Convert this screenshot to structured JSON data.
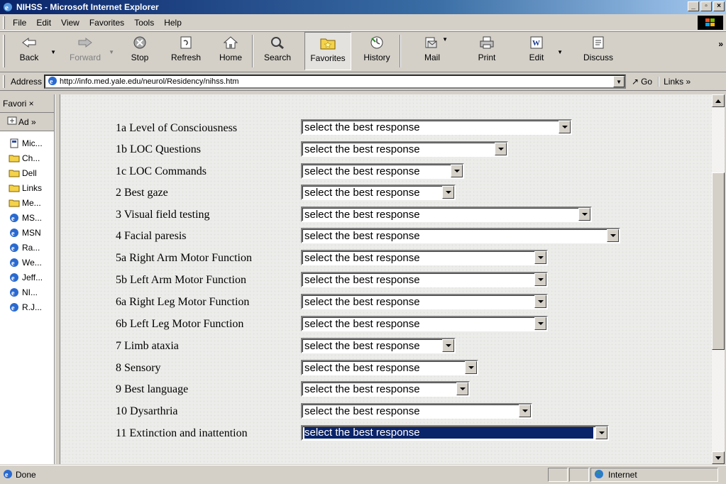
{
  "window": {
    "title": "NIHSS - Microsoft Internet Explorer",
    "min": "_",
    "max": "▫",
    "close": "×"
  },
  "menu": [
    "File",
    "Edit",
    "View",
    "Favorites",
    "Tools",
    "Help"
  ],
  "toolbar": {
    "back": "Back",
    "forward": "Forward",
    "stop": "Stop",
    "refresh": "Refresh",
    "home": "Home",
    "search": "Search",
    "favorites": "Favorites",
    "history": "History",
    "mail": "Mail",
    "print": "Print",
    "edit": "Edit",
    "discuss": "Discuss",
    "more": "»"
  },
  "address": {
    "label": "Address",
    "url": "http://info.med.yale.edu/neurol/Residency/nihss.htm",
    "go": "Go",
    "links": "Links »"
  },
  "favorites": {
    "header": "Favori ×",
    "add": "Ad »",
    "items": [
      "Mic...",
      "Ch...",
      "Dell",
      "Links",
      "Me...",
      "MS...",
      "MSN",
      "Ra...",
      "We...",
      "Jeff...",
      "NI...",
      "R.J..."
    ]
  },
  "form": {
    "items": [
      {
        "label": "1a  Level of Consciousness",
        "value": "select the best response"
      },
      {
        "label": "1b  LOC Questions",
        "value": "select the best response"
      },
      {
        "label": "1c  LOC Commands",
        "value": "select the best response"
      },
      {
        "label": "2   Best gaze",
        "value": "select the best response"
      },
      {
        "label": "3   Visual field testing",
        "value": "select the best response"
      },
      {
        "label": "4   Facial paresis",
        "value": "select the best response"
      },
      {
        "label": "5a  Right Arm Motor Function",
        "value": "select the best response"
      },
      {
        "label": "5b  Left Arm Motor Function",
        "value": "select the best response"
      },
      {
        "label": "6a  Right Leg Motor Function",
        "value": "select the best response"
      },
      {
        "label": "6b  Left Leg Motor Function",
        "value": "select the best response"
      },
      {
        "label": "7   Limb ataxia",
        "value": "select the best response"
      },
      {
        "label": "8   Sensory",
        "value": "select the best response"
      },
      {
        "label": "9   Best language",
        "value": "select the best response"
      },
      {
        "label": "10  Dysarthria",
        "value": "select the best response"
      },
      {
        "label": "11  Extinction and inattention",
        "value": "select the best response"
      }
    ]
  },
  "status": {
    "text": "Done",
    "zone": "Internet"
  }
}
